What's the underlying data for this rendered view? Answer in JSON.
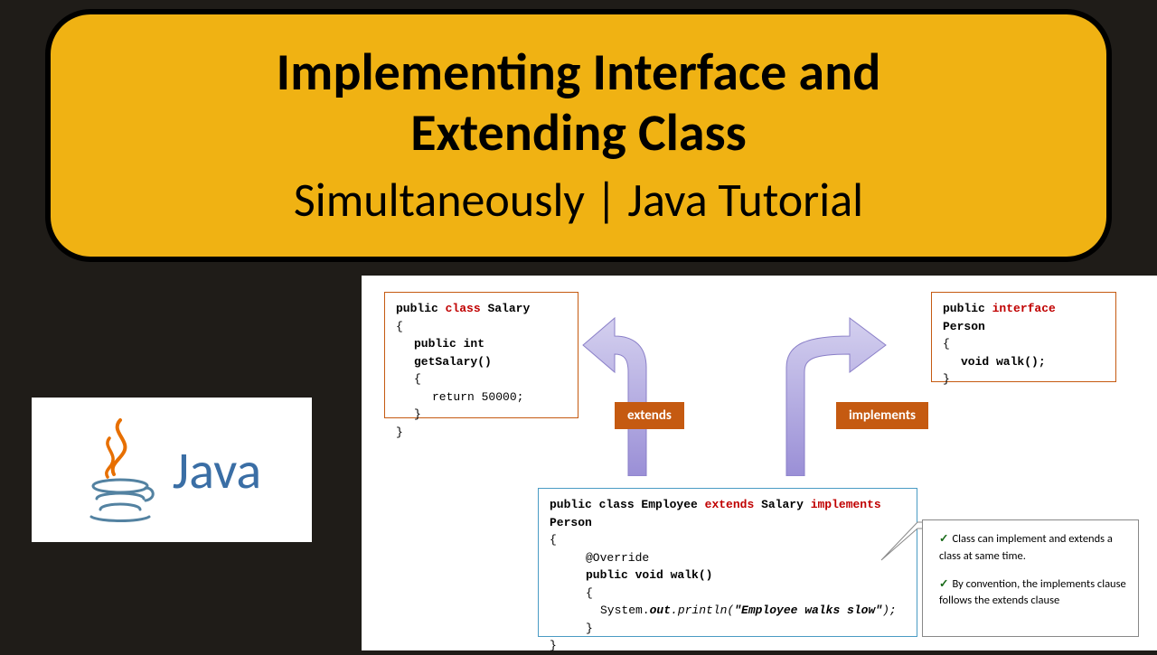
{
  "title": {
    "line1a": "Implementing Interface and",
    "line1b": "Extending Class",
    "line2": "Simultaneously | Java Tutorial"
  },
  "logo": {
    "text": "Java"
  },
  "diagram": {
    "salary": {
      "l1_pub": "public",
      "l1_class": "class",
      "l1_name": "Salary",
      "l2": "{",
      "l3_pub": "public int getSalary()",
      "l4": "{",
      "l5": "return 50000;",
      "l6": "}",
      "l7": "}"
    },
    "person": {
      "l1_pub": "public",
      "l1_iface": "interface",
      "l1_name": "Person",
      "l2": "{",
      "l3": "void walk();",
      "l4": "}"
    },
    "employee": {
      "l1_pub": "public class Employee",
      "l1_ext": "extends",
      "l1_sal": "Salary",
      "l1_impl": "implements",
      "l1_per": "Person",
      "l2": "{",
      "l3": "@Override",
      "l4": "public void walk()",
      "l5": "{",
      "l6a": "System.",
      "l6b": "out",
      "l6c": ".println(",
      "l6d": "\"Employee walks slow\"",
      "l6e": ");",
      "l7": "}",
      "l8": "}"
    },
    "tags": {
      "extends": "extends",
      "implements": "implements"
    },
    "notes": {
      "n1": "Class can implement and extends a class at same time.",
      "n2": "By convention, the implements clause follows the extends clause"
    }
  }
}
